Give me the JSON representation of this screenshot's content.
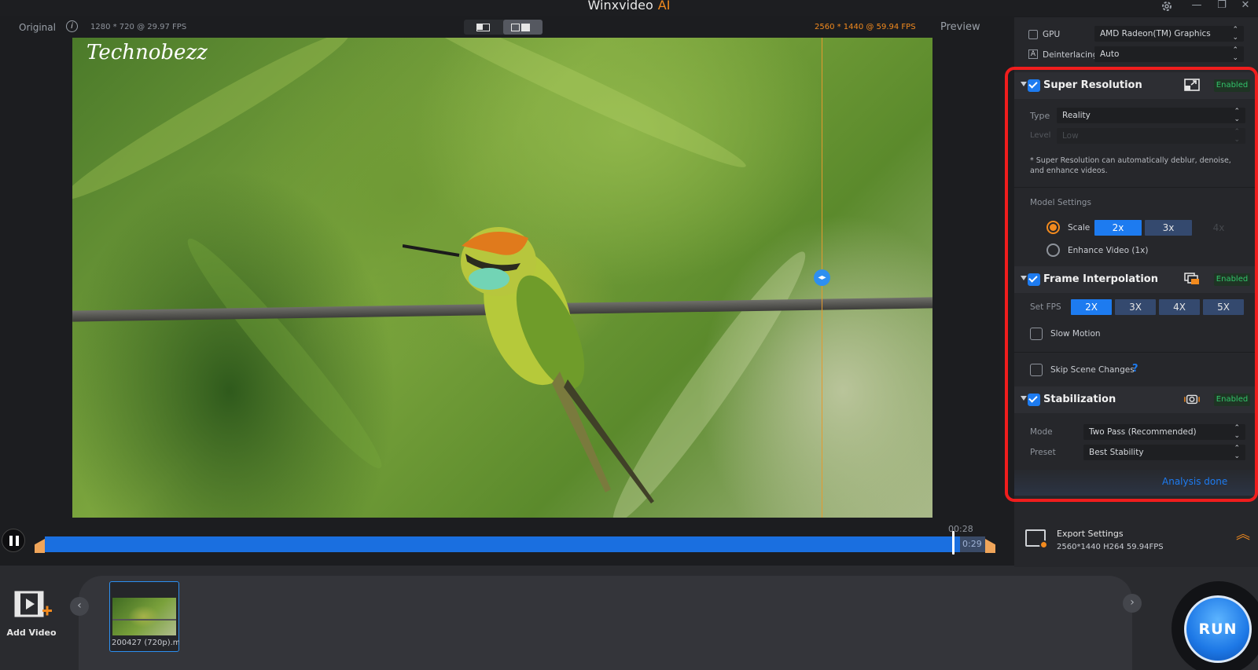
{
  "app": {
    "title": "Winxvideo",
    "title_suffix": "AI"
  },
  "window": {
    "settings_icon": "gear-icon",
    "minimize": "—",
    "restore": "❐",
    "close": "✕"
  },
  "preview": {
    "original_label": "Original",
    "info_glyph": "i",
    "original_resolution": "1280 * 720 @ 29.97 FPS",
    "output_resolution": "2560 * 1440 @ 59.94 FPS",
    "preview_label": "Preview",
    "watermark": "Technobezz",
    "split_handle_glyph": "◂▸"
  },
  "timeline": {
    "current_time": "00:28",
    "end_time": "0:29",
    "progress": 0.973
  },
  "tray": {
    "add_video_label": "Add Video",
    "thumbnail_label": "200427 (720p).m",
    "nav_left": "‹",
    "nav_right": "›",
    "run_label": "RUN"
  },
  "panel": {
    "gpu": {
      "label": "GPU",
      "value": "AMD Radeon(TM) Graphics",
      "checked": false
    },
    "deinterlacing": {
      "label": "Deinterlacing",
      "value": "Auto"
    },
    "super_resolution": {
      "title": "Super Resolution",
      "badge": "Enabled",
      "checked": true,
      "type_label": "Type",
      "type_value": "Reality",
      "level_label": "Level",
      "level_value": "Low",
      "note_line1": "* Super Resolution can automatically deblur, denoise,",
      "note_line2": "and enhance videos.",
      "model_settings_label": "Model Settings",
      "scale_label": "Scale",
      "scale_options": [
        "2x",
        "3x",
        "4x"
      ],
      "scale_selected": "2x",
      "enhance_label": "Enhance Video (1x)"
    },
    "frame_interpolation": {
      "title": "Frame Interpolation",
      "badge": "Enabled",
      "checked": true,
      "fps_label": "Set FPS",
      "fps_options": [
        "2X",
        "3X",
        "4X",
        "5X"
      ],
      "fps_selected": "2X",
      "slow_motion_label": "Slow Motion",
      "skip_scene_label": "Skip Scene Changes",
      "help_glyph": "?"
    },
    "stabilization": {
      "title": "Stabilization",
      "badge": "Enabled",
      "checked": true,
      "mode_label": "Mode",
      "mode_value": "Two Pass (Recommended)",
      "preset_label": "Preset",
      "preset_value": "Best Stability",
      "analysis_status": "Analysis done"
    },
    "export": {
      "title": "Export Settings",
      "details": "2560*1440  H264  59.94FPS",
      "chevron": "︽"
    }
  },
  "colors": {
    "accent_blue": "#1d7bf0",
    "accent_orange": "#f28a1e",
    "enabled_green": "#32c46a",
    "highlight_red": "#f01d1d"
  }
}
